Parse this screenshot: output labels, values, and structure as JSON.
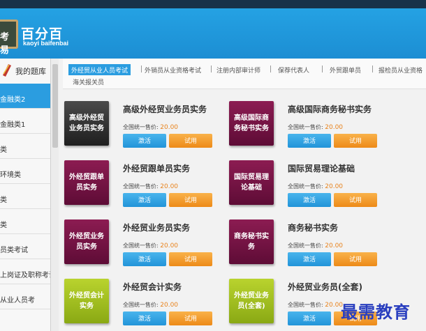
{
  "header": {
    "logo_board_text": "考易",
    "logo_title": "百分百",
    "logo_subtitle": "kaoyi baifenbai"
  },
  "sidebar": {
    "title": "我的题库",
    "items": [
      {
        "label": "金融类2",
        "active": true
      },
      {
        "label": "金融类1",
        "active": false
      },
      {
        "label": "类",
        "active": false
      },
      {
        "label": "环境类",
        "active": false
      },
      {
        "label": "类",
        "active": false
      },
      {
        "label": "类",
        "active": false
      },
      {
        "label": "员类考试",
        "active": false
      },
      {
        "label": "上岗证及职称考试",
        "active": false
      },
      {
        "label": "从业人员考",
        "active": false
      }
    ]
  },
  "tabs": [
    {
      "label": "外经贸从业人员考试",
      "active": true
    },
    {
      "label": "外销员从业资格考试",
      "active": false
    },
    {
      "label": "注册内部审计师",
      "active": false
    },
    {
      "label": "保荐代表人",
      "active": false
    },
    {
      "label": "外贸跟单员",
      "active": false
    },
    {
      "label": "报检员从业资格",
      "active": false
    },
    {
      "label": "海关报关员",
      "active": false
    }
  ],
  "products": [
    {
      "cover": "高级外经贸业务员实务",
      "cover_color": "#2a2a2a",
      "title": "高级外经贸业务员实务",
      "price_label": "全国统一售价:",
      "price": "20.00",
      "activate": "激活",
      "trial": "试用"
    },
    {
      "cover": "高级国际商务秘书实务",
      "cover_color": "#7a1446",
      "title": "高级国际商务秘书实务",
      "price_label": "全国统一售价:",
      "price": "20.00",
      "activate": "激活",
      "trial": "试用"
    },
    {
      "cover": "外经贸跟单员实务",
      "cover_color": "#7a1446",
      "title": "外经贸跟单员实务",
      "price_label": "全国统一售价:",
      "price": "20.00",
      "activate": "激活",
      "trial": "试用"
    },
    {
      "cover": "国际贸易理论基础",
      "cover_color": "#7a1446",
      "title": "国际贸易理论基础",
      "price_label": "全国统一售价:",
      "price": "20.00",
      "activate": "激活",
      "trial": "试用"
    },
    {
      "cover": "外经贸业务员实务",
      "cover_color": "#7a1446",
      "title": "外经贸业务员实务",
      "price_label": "全国统一售价:",
      "price": "20.00",
      "activate": "激活",
      "trial": "试用"
    },
    {
      "cover": "商务秘书实务",
      "cover_color": "#7a1446",
      "title": "商务秘书实务",
      "price_label": "全国统一售价:",
      "price": "20.00",
      "activate": "激活",
      "trial": "试用"
    },
    {
      "cover": "外经贸会计实务",
      "cover_color": "#a2c121",
      "title": "外经贸会计实务",
      "price_label": "全国统一售价:",
      "price": "20.00",
      "activate": "激活",
      "trial": "试用"
    },
    {
      "cover": "外经贸业务员(全套)",
      "cover_color": "#a2c121",
      "title": "外经贸业务员(全套)",
      "price_label": "全国统一售价:",
      "price": "20.00",
      "activate": "激活",
      "trial": "试用"
    }
  ],
  "watermark": "最需教育"
}
